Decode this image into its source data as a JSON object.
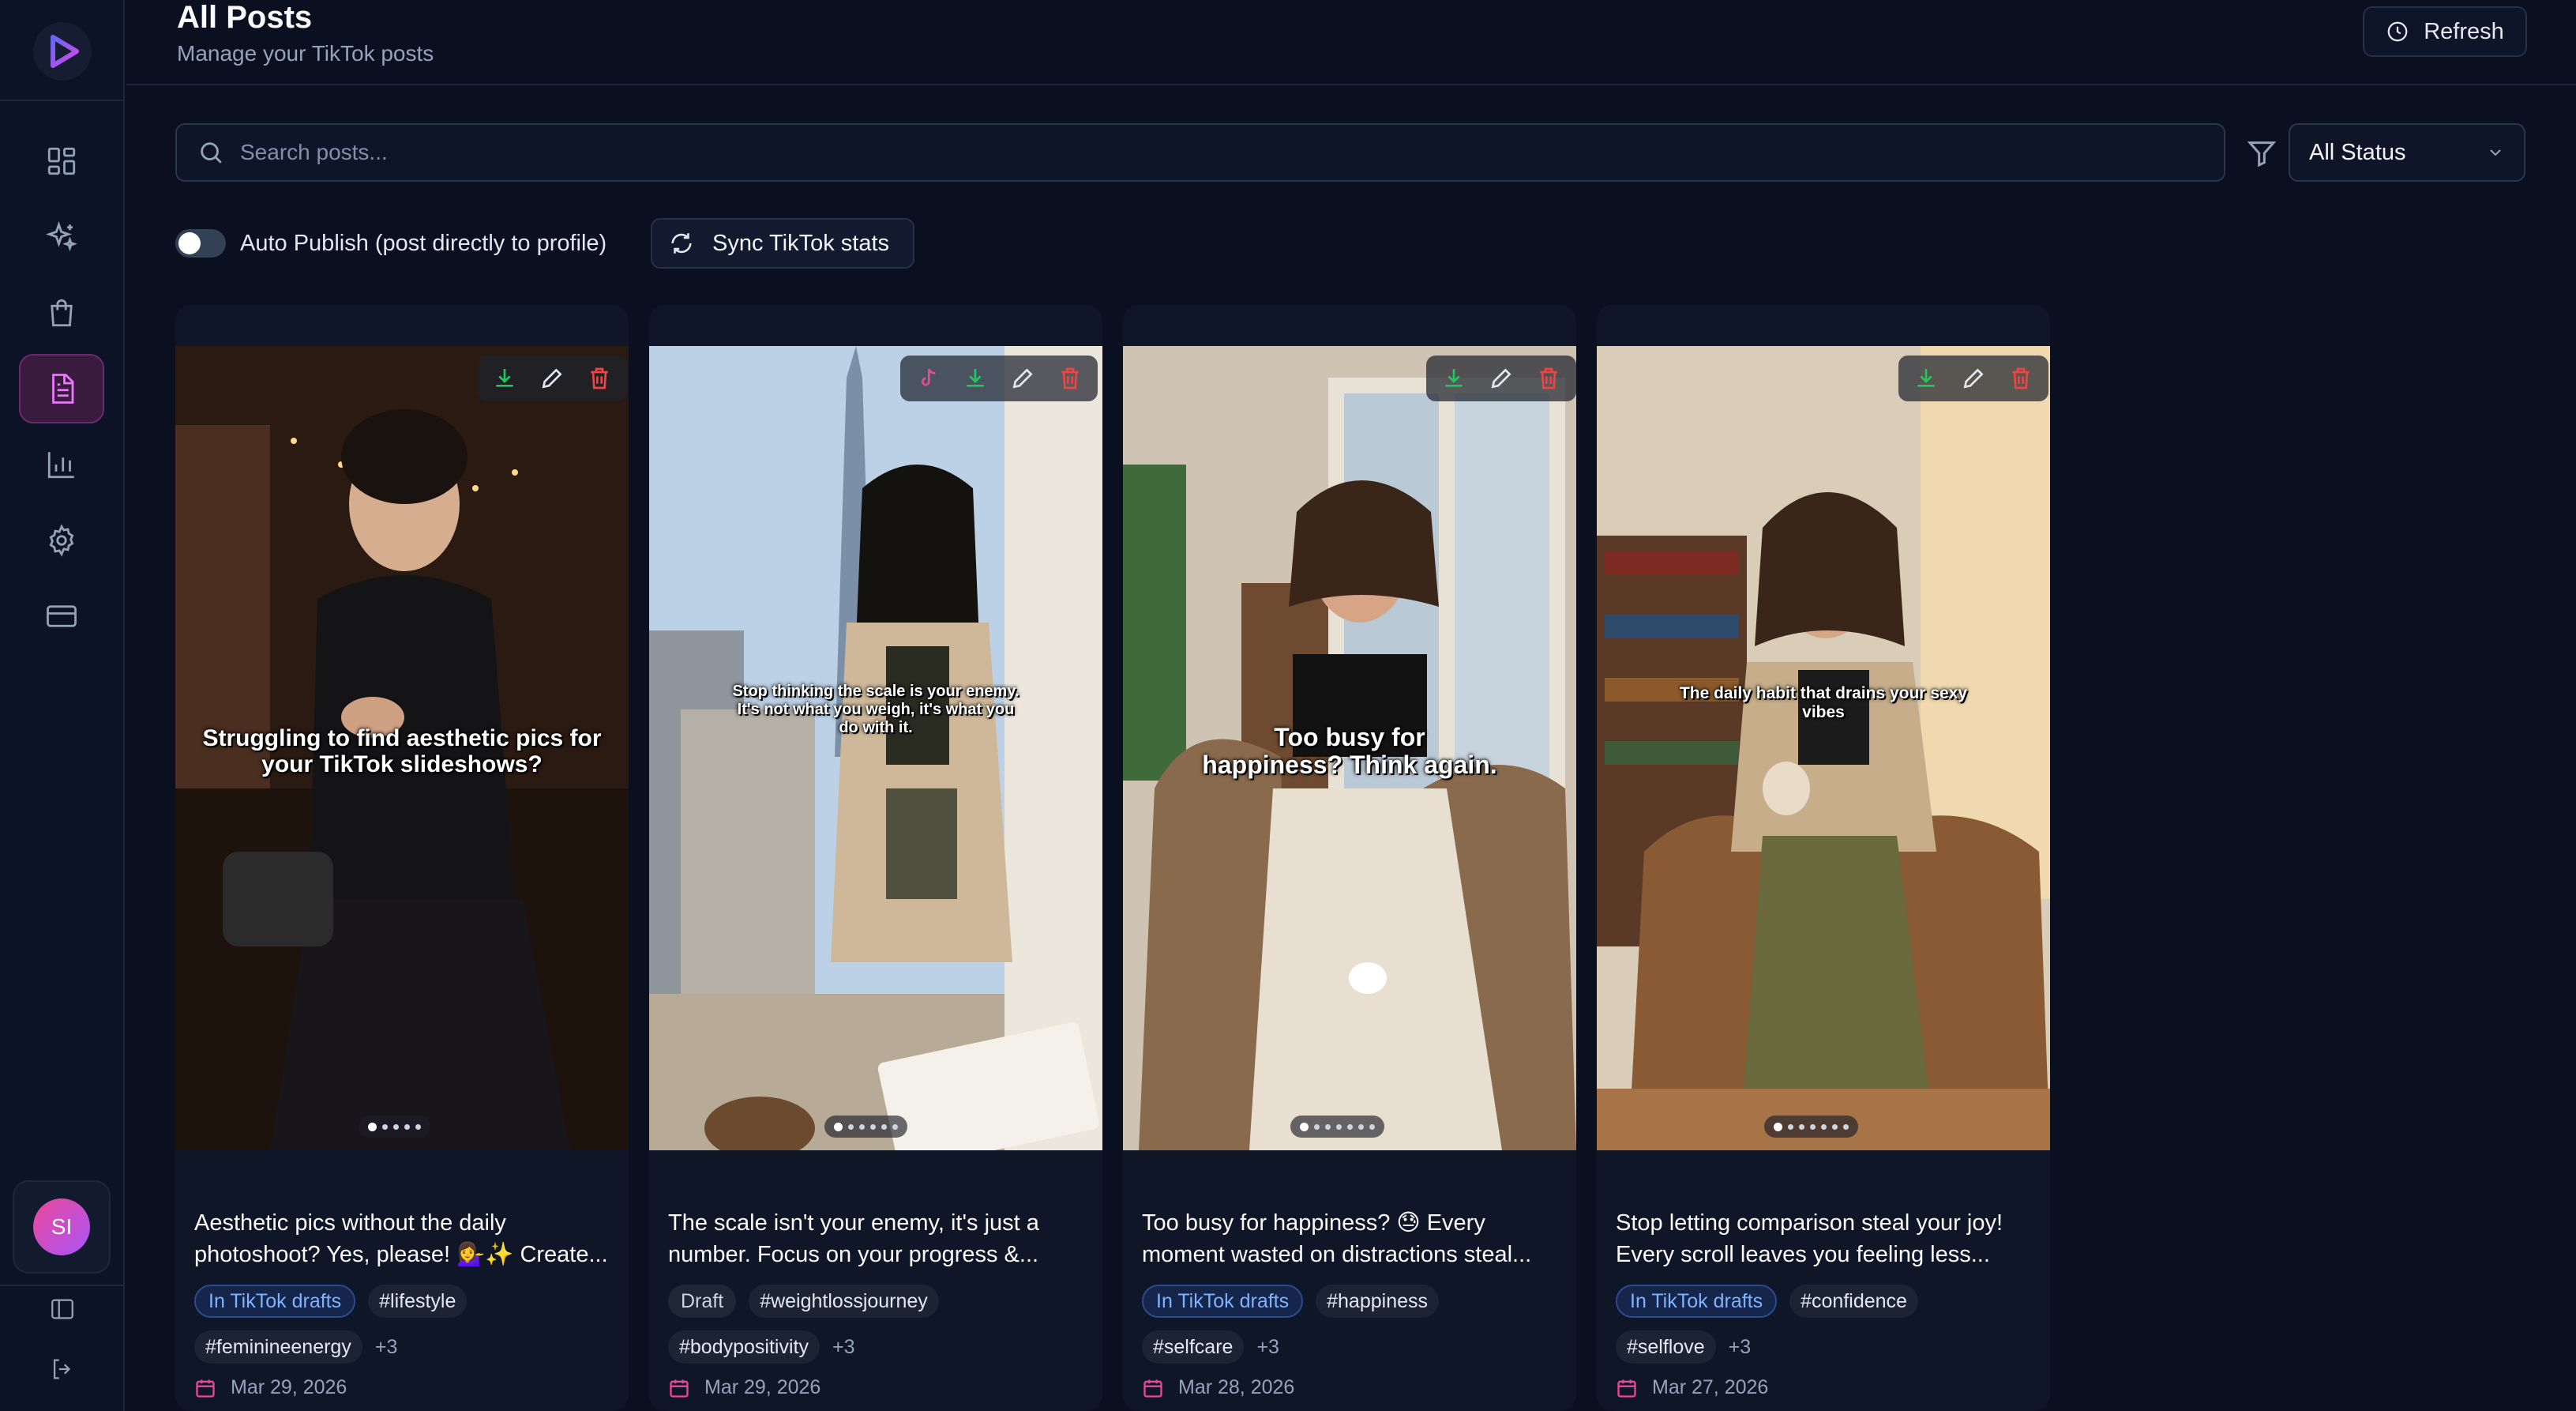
{
  "header": {
    "title": "All Posts",
    "subtitle": "Manage your TikTok posts",
    "refresh_label": "Refresh"
  },
  "search": {
    "placeholder": "Search posts...",
    "value": ""
  },
  "filter": {
    "status_value": "All Status"
  },
  "toolbar": {
    "auto_publish_label": "Auto Publish (post directly to profile)",
    "auto_publish_on": false,
    "sync_label": "Sync TikTok stats"
  },
  "sidebar": {
    "nav": [
      "dashboard",
      "generate",
      "products",
      "posts",
      "analytics",
      "settings",
      "billing"
    ],
    "active": "posts",
    "user_initials": "SI"
  },
  "colors": {
    "accent": "#c026d3",
    "background": "#0b1020",
    "badge_tiktok_text": "#7db3ff",
    "download": "#22c55e",
    "delete": "#ef4444",
    "date_icon": "#ec4899"
  },
  "posts": [
    {
      "overlay": "Struggling to find aesthetic pics for your TikTok slideshows?",
      "caption": "Aesthetic pics without the daily photoshoot? Yes, please! 💁‍♀️✨ Create...",
      "status": "In TikTok drafts",
      "tags": [
        "#lifestyle",
        "#feminineenergy"
      ],
      "more": "+3",
      "date": "Mar 29, 2026",
      "slides": 5,
      "has_tiktok_icon": false
    },
    {
      "overlay": "Stop thinking the scale is your enemy. It's not what you weigh, it's what you do with it.",
      "caption": "The scale isn't your enemy, it's just a number. Focus on your progress &...",
      "status": "Draft",
      "tags": [
        "#weightlossjourney",
        "#bodypositivity"
      ],
      "more": "+3",
      "date": "Mar 29, 2026",
      "slides": 6,
      "has_tiktok_icon": true
    },
    {
      "overlay": "Too busy for happiness? Think again.",
      "caption": "Too busy for happiness? 😓 Every moment wasted on distractions steal...",
      "status": "In TikTok drafts",
      "tags": [
        "#happiness",
        "#selfcare"
      ],
      "more": "+3",
      "date": "Mar 28, 2026",
      "slides": 7,
      "has_tiktok_icon": false
    },
    {
      "overlay": "The daily habit that drains your sexy vibes",
      "caption": "Stop letting comparison steal your joy! Every scroll leaves you feeling less...",
      "status": "In TikTok drafts",
      "tags": [
        "#confidence",
        "#selflove"
      ],
      "more": "+3",
      "date": "Mar 27, 2026",
      "slides": 7,
      "has_tiktok_icon": false
    }
  ]
}
